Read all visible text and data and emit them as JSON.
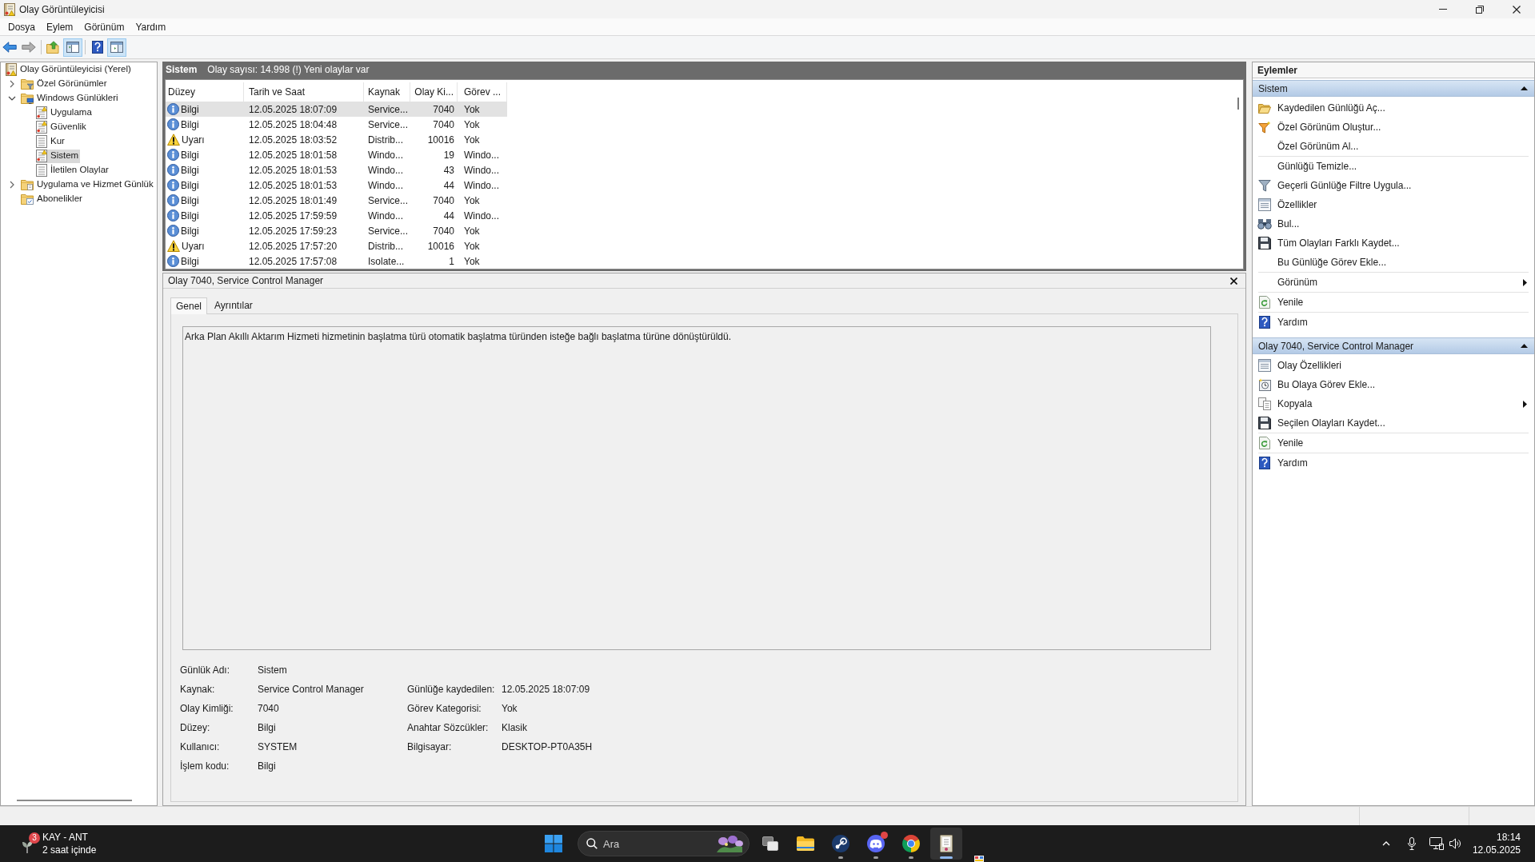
{
  "window": {
    "title": "Olay Görüntüleyicisi"
  },
  "menu": [
    {
      "label": "Dosya"
    },
    {
      "label": "Eylem"
    },
    {
      "label": "Görünüm"
    },
    {
      "label": "Yardım"
    }
  ],
  "toolbar": [
    [
      {
        "kind": "back",
        "disabled": false,
        "on": false
      },
      {
        "kind": "forward",
        "disabled": true,
        "on": false
      }
    ],
    [
      {
        "kind": "up",
        "disabled": false,
        "on": false
      },
      {
        "kind": "tree-pane",
        "disabled": false,
        "on": true
      }
    ],
    [
      {
        "kind": "help",
        "disabled": false,
        "on": false
      },
      {
        "kind": "action-pane",
        "disabled": false,
        "on": true
      }
    ]
  ],
  "tree": [
    {
      "label": "Olay Görüntüleyicisi (Yerel)",
      "kind": "root",
      "selected": false,
      "children": [
        {
          "label": "Özel Görünümler",
          "kind": "folder-filter",
          "expanded": false,
          "selected": false
        },
        {
          "label": "Windows Günlükleri",
          "kind": "folder-monitor",
          "expanded": true,
          "selected": false,
          "children": [
            {
              "label": "Uygulama",
              "kind": "log-alert",
              "selected": false
            },
            {
              "label": "Güvenlik",
              "kind": "log-alert",
              "selected": false
            },
            {
              "label": "Kur",
              "kind": "log",
              "selected": false
            },
            {
              "label": "Sistem",
              "kind": "log-alert",
              "selected": true
            },
            {
              "label": "İletilen Olaylar",
              "kind": "log",
              "selected": false
            }
          ]
        },
        {
          "label": "Uygulama ve Hizmet Günlük",
          "kind": "folder-doc",
          "expanded": false,
          "selected": false
        },
        {
          "label": "Abonelikler",
          "kind": "folder-check",
          "selected": false
        }
      ]
    }
  ],
  "log_view": {
    "title": "Sistem",
    "summary": "Olay sayısı: 14.998 (!) Yeni olaylar var",
    "columns": [
      {
        "label": "Düzey"
      },
      {
        "label": "Tarih ve Saat"
      },
      {
        "label": "Kaynak"
      },
      {
        "label": "Olay Ki..."
      },
      {
        "label": "Görev ..."
      }
    ],
    "rows": [
      {
        "kind": "info",
        "severity": "Bilgi",
        "date": "12.05.2025 18:07:09",
        "source": "Service...",
        "event_id": "7040",
        "task": "Yok",
        "selected": true
      },
      {
        "kind": "info",
        "severity": "Bilgi",
        "date": "12.05.2025 18:04:48",
        "source": "Service...",
        "event_id": "7040",
        "task": "Yok",
        "selected": false
      },
      {
        "kind": "warning",
        "severity": "Uyarı",
        "date": "12.05.2025 18:03:52",
        "source": "Distrib...",
        "event_id": "10016",
        "task": "Yok",
        "selected": false
      },
      {
        "kind": "info",
        "severity": "Bilgi",
        "date": "12.05.2025 18:01:58",
        "source": "Windo...",
        "event_id": "19",
        "task": "Windo...",
        "selected": false
      },
      {
        "kind": "info",
        "severity": "Bilgi",
        "date": "12.05.2025 18:01:53",
        "source": "Windo...",
        "event_id": "43",
        "task": "Windo...",
        "selected": false
      },
      {
        "kind": "info",
        "severity": "Bilgi",
        "date": "12.05.2025 18:01:53",
        "source": "Windo...",
        "event_id": "44",
        "task": "Windo...",
        "selected": false
      },
      {
        "kind": "info",
        "severity": "Bilgi",
        "date": "12.05.2025 18:01:49",
        "source": "Service...",
        "event_id": "7040",
        "task": "Yok",
        "selected": false
      },
      {
        "kind": "info",
        "severity": "Bilgi",
        "date": "12.05.2025 17:59:59",
        "source": "Windo...",
        "event_id": "44",
        "task": "Windo...",
        "selected": false
      },
      {
        "kind": "info",
        "severity": "Bilgi",
        "date": "12.05.2025 17:59:23",
        "source": "Service...",
        "event_id": "7040",
        "task": "Yok",
        "selected": false
      },
      {
        "kind": "warning",
        "severity": "Uyarı",
        "date": "12.05.2025 17:57:20",
        "source": "Distrib...",
        "event_id": "10016",
        "task": "Yok",
        "selected": false
      },
      {
        "kind": "info",
        "severity": "Bilgi",
        "date": "12.05.2025 17:57:08",
        "source": "Isolate...",
        "event_id": "1",
        "task": "Yok",
        "selected": false
      }
    ]
  },
  "detail": {
    "title": "Olay 7040, Service Control Manager",
    "tabs": [
      {
        "label": "Genel",
        "selected": true
      },
      {
        "label": "Ayrıntılar",
        "selected": false
      }
    ],
    "description": "Arka Plan Akıllı Aktarım Hizmeti hizmetinin başlatma türü otomatik başlatma türünden isteğe bağlı başlatma türüne dönüştürüldü.",
    "properties": [
      [
        {
          "label": "Günlük Adı:",
          "value": "Sistem"
        }
      ],
      [
        {
          "label": "Kaynak:",
          "value": "Service Control Manager"
        },
        {
          "label": "Günlüğe kaydedilen:",
          "value": "12.05.2025 18:07:09"
        }
      ],
      [
        {
          "label": "Olay Kimliği:",
          "value": "7040"
        },
        {
          "label": "Görev Kategorisi:",
          "value": "Yok"
        }
      ],
      [
        {
          "label": "Düzey:",
          "value": "Bilgi"
        },
        {
          "label": "Anahtar Sözcükler:",
          "value": "Klasik"
        }
      ],
      [
        {
          "label": "Kullanıcı:",
          "value": "SYSTEM"
        },
        {
          "label": "Bilgisayar:",
          "value": "DESKTOP-PT0A35H"
        }
      ],
      [
        {
          "label": "İşlem kodu:",
          "value": "Bilgi"
        }
      ]
    ]
  },
  "actions": {
    "title": "Eylemler",
    "sections": [
      {
        "title": "Sistem",
        "expanded": true,
        "groups": [
          [
            {
              "label": "Kaydedilen Günlüğü Aç...",
              "kind": "open",
              "submenu": false
            },
            {
              "label": "Özel Görünüm Oluştur...",
              "kind": "filter-new",
              "submenu": false
            },
            {
              "label": "Özel Görünüm Al...",
              "kind": "none",
              "submenu": false
            }
          ],
          [
            {
              "label": "Günlüğü Temizle...",
              "kind": "none",
              "submenu": false
            },
            {
              "label": "Geçerli Günlüğe Filtre Uygula...",
              "kind": "filter",
              "submenu": false
            },
            {
              "label": "Özellikler",
              "kind": "properties",
              "submenu": false
            },
            {
              "label": "Bul...",
              "kind": "find",
              "submenu": false
            },
            {
              "label": "Tüm Olayları Farklı Kaydet...",
              "kind": "save",
              "submenu": false
            },
            {
              "label": "Bu Günlüğe Görev Ekle...",
              "kind": "none",
              "submenu": false
            }
          ],
          [
            {
              "label": "Görünüm",
              "kind": "none",
              "submenu": true
            }
          ],
          [
            {
              "label": "Yenile",
              "kind": "refresh",
              "submenu": false
            }
          ],
          [
            {
              "label": "Yardım",
              "kind": "help",
              "submenu": false
            }
          ]
        ]
      },
      {
        "title": "Olay 7040, Service Control Manager",
        "expanded": true,
        "groups": [
          [
            {
              "label": "Olay Özellikleri",
              "kind": "properties",
              "submenu": false
            },
            {
              "label": "Bu Olaya Görev Ekle...",
              "kind": "task",
              "submenu": false
            },
            {
              "label": "Kopyala",
              "kind": "copy",
              "submenu": true
            },
            {
              "label": "Seçilen Olayları Kaydet...",
              "kind": "save",
              "submenu": false
            }
          ],
          [
            {
              "label": "Yenile",
              "kind": "refresh",
              "submenu": false
            }
          ],
          [
            {
              "label": "Yardım",
              "kind": "help",
              "submenu": false
            }
          ]
        ]
      }
    ]
  },
  "taskbar": {
    "widget": {
      "badge": "3",
      "title": "KAY - ANT",
      "subtitle": "2 saat içinde"
    },
    "search": {
      "placeholder": "Ara"
    },
    "apps": [
      {
        "kind": "stack",
        "running": false,
        "active": false,
        "notification": false
      },
      {
        "kind": "folder",
        "running": false,
        "active": false,
        "notification": false
      },
      {
        "kind": "round-logo",
        "running": true,
        "active": false,
        "notification": false
      },
      {
        "kind": "controller",
        "running": true,
        "active": false,
        "notification": true
      },
      {
        "kind": "ring",
        "running": true,
        "active": false,
        "notification": false
      },
      {
        "kind": "log-book",
        "running": true,
        "active": true,
        "notification": false
      }
    ],
    "clock": {
      "time": "18:14",
      "date": "12.05.2025"
    }
  }
}
